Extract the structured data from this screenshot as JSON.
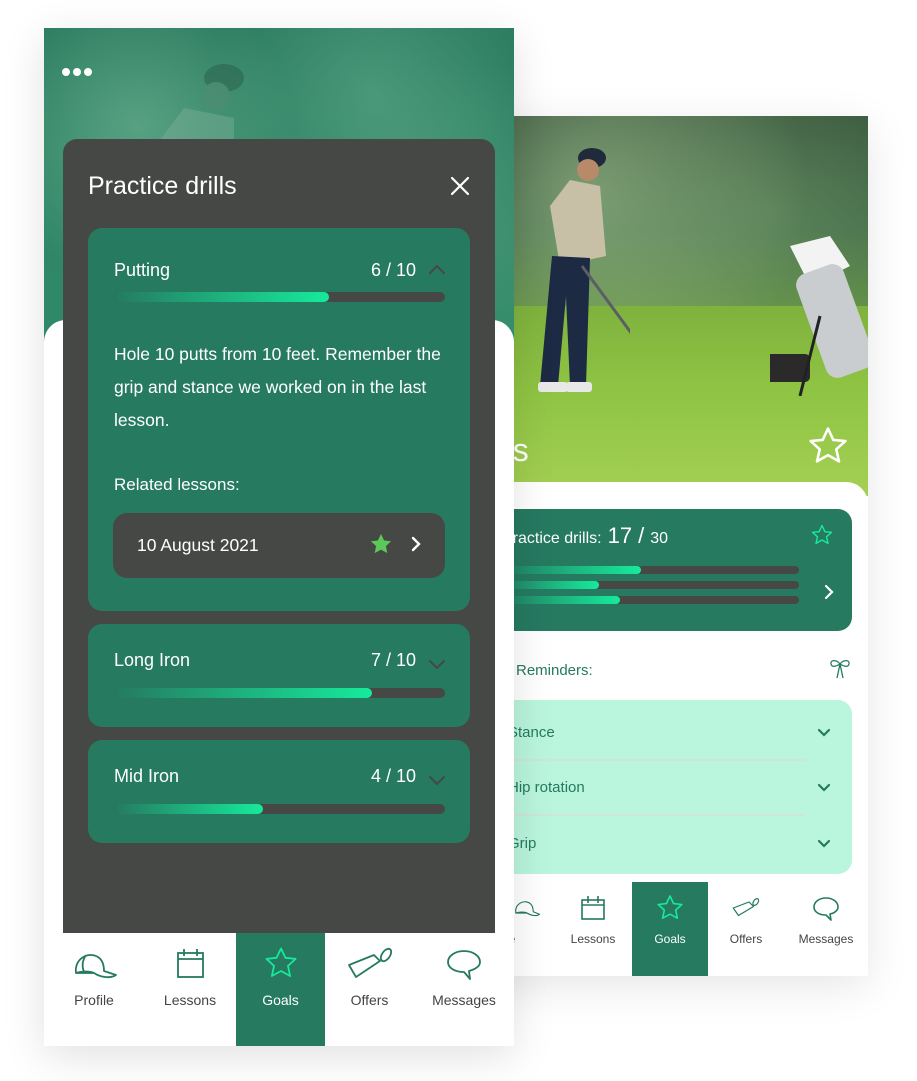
{
  "colors": {
    "brand_green": "#257a60",
    "accent_mint": "#16ea9c",
    "dark_surface": "#464845",
    "reminder_bg": "#baf5dd",
    "star_filled": "#5cc85a"
  },
  "front": {
    "menu_icon": "more-dots-icon",
    "modal": {
      "title": "Practice drills",
      "close_icon": "close-icon",
      "drills": [
        {
          "name": "Putting",
          "score": "6 / 10",
          "progress": 0.65,
          "expanded": true,
          "chevron": "chevron-up-icon",
          "description": "Hole 10 putts from 10 feet. Remember the grip and stance we worked on in the last lesson.",
          "related_label": "Related lessons:",
          "related_lessons": [
            {
              "date": "10 August 2021",
              "starred": true
            }
          ]
        },
        {
          "name": "Long Iron",
          "score": "7 / 10",
          "progress": 0.78,
          "expanded": false,
          "chevron": "chevron-down-icon"
        },
        {
          "name": "Mid Iron",
          "score": "4 / 10",
          "progress": 0.45,
          "expanded": false,
          "chevron": "chevron-down-icon"
        }
      ]
    },
    "tabs": [
      {
        "label": "Profile",
        "icon": "cap-icon",
        "active": false
      },
      {
        "label": "Lessons",
        "icon": "calendar-icon",
        "active": false
      },
      {
        "label": "Goals",
        "icon": "star-icon",
        "active": true
      },
      {
        "label": "Offers",
        "icon": "tag-icon",
        "active": false
      },
      {
        "label": "Messages",
        "icon": "speech-bubble-icon",
        "active": false
      }
    ]
  },
  "back": {
    "hero_title": "oals",
    "summary": {
      "label": "Practice drills:",
      "done": "17",
      "slash": "/",
      "total": "30",
      "bars": [
        0.47,
        0.33,
        0.4
      ]
    },
    "reminders_label": "Reminders:",
    "reminders": [
      {
        "label": "Stance"
      },
      {
        "label": "Hip rotation"
      },
      {
        "label": "Grip"
      }
    ],
    "tabs": [
      {
        "label": "file",
        "icon": "cap-icon",
        "active": false
      },
      {
        "label": "Lessons",
        "icon": "calendar-icon",
        "active": false
      },
      {
        "label": "Goals",
        "icon": "star-icon",
        "active": true
      },
      {
        "label": "Offers",
        "icon": "tag-icon",
        "active": false
      },
      {
        "label": "Messages",
        "icon": "speech-bubble-icon",
        "active": false
      }
    ]
  }
}
